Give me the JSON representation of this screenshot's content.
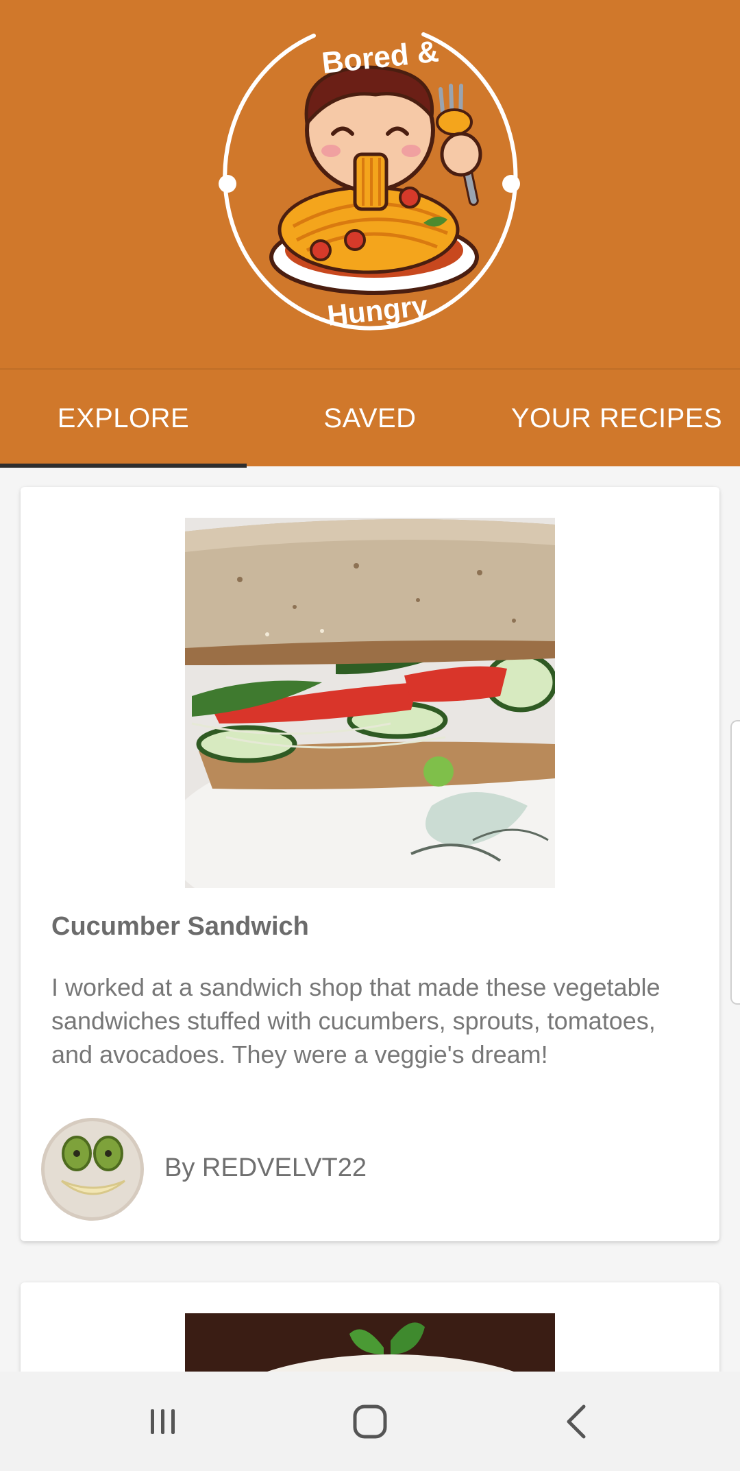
{
  "header": {
    "logo_top_text": "Bored &",
    "logo_bottom_text": "Hungry",
    "background_color": "#d0782b"
  },
  "tabs": [
    {
      "label": "EXPLORE",
      "selected": true
    },
    {
      "label": "SAVED",
      "selected": false
    },
    {
      "label": "YOUR RECIPES",
      "selected": false
    }
  ],
  "feed": {
    "cards": [
      {
        "image_icon": "sandwich-photo",
        "title": "Cucumber Sandwich",
        "description": "I worked at a sandwich shop that made these vegetable sandwiches stuffed with cucumbers, sprouts, tomatoes, and avocadoes. They were a veggie's dream!",
        "author": "By REDVELVT22",
        "author_avatar_icon": "kiwi-smiley-avatar"
      },
      {
        "image_icon": "pasta-basil-photo"
      }
    ]
  },
  "navbar": {
    "recent_icon": "recent-apps-icon",
    "home_icon": "home-icon",
    "back_icon": "back-icon"
  }
}
